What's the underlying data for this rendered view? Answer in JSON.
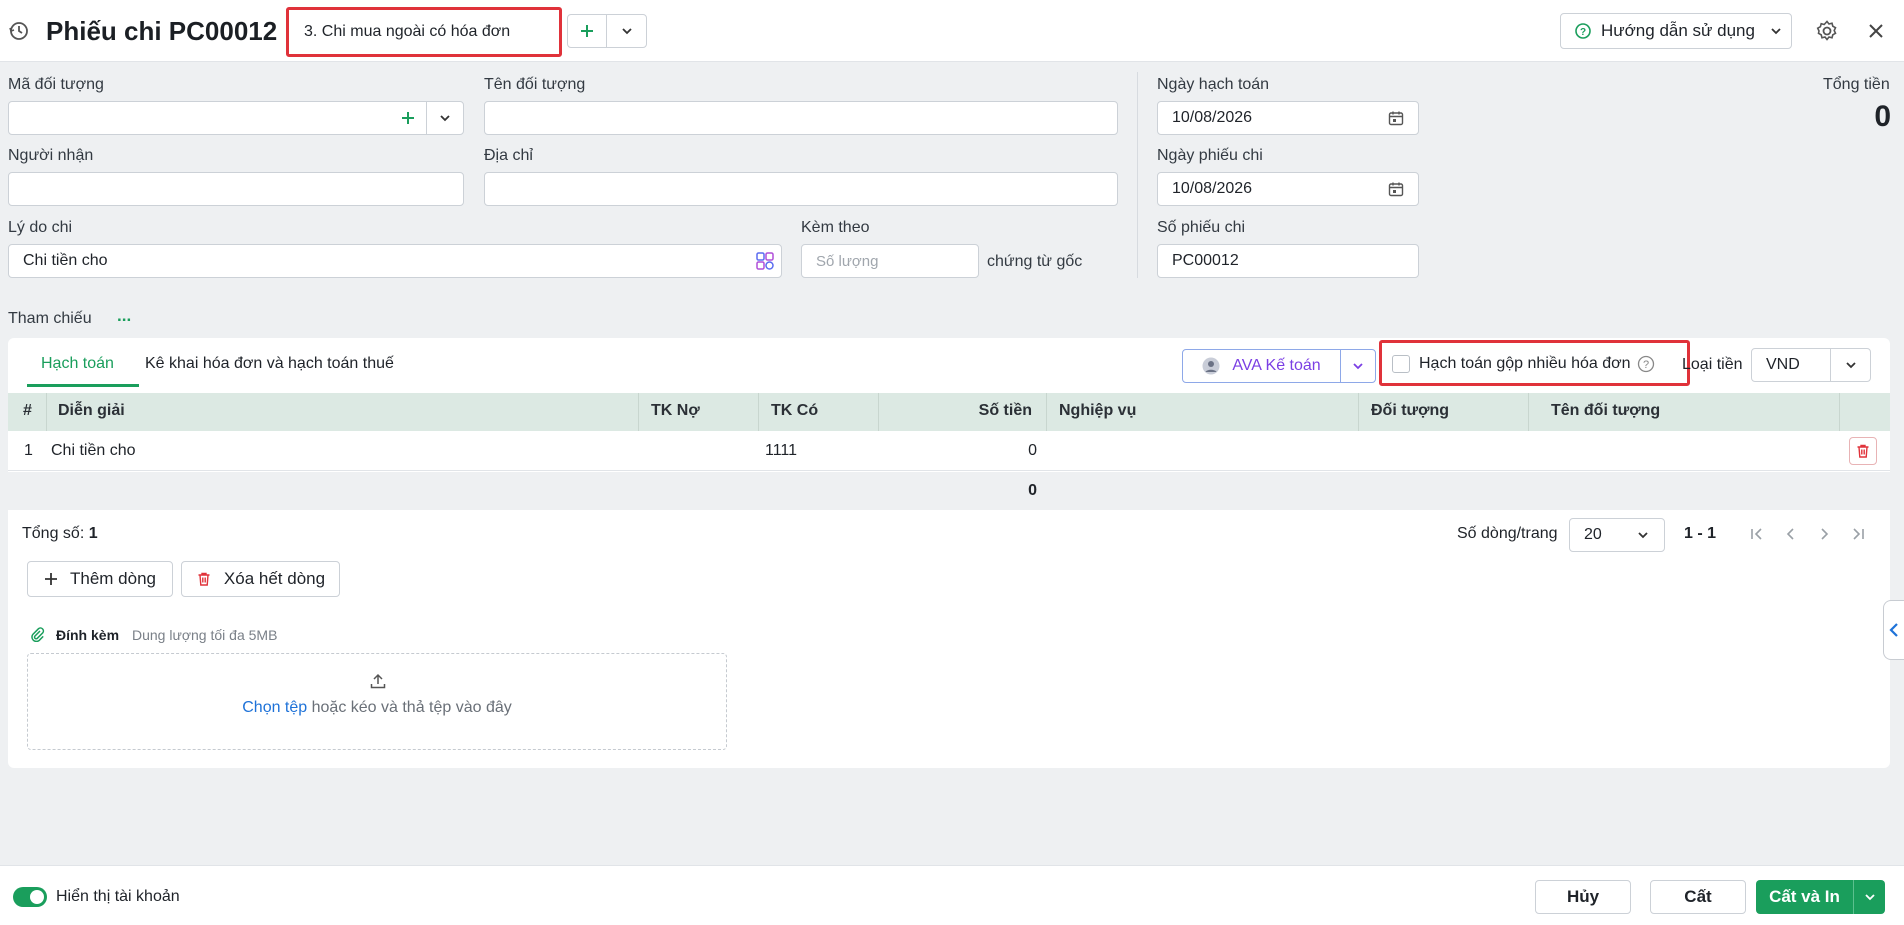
{
  "header": {
    "title": "Phiếu chi PC00012",
    "type_select": "3. Chi mua ngoài có hóa đơn",
    "help_label": "Hướng dẫn sử dụng"
  },
  "form": {
    "ma_doi_tuong_label": "Mã đối tượng",
    "ma_doi_tuong_value": "",
    "ten_doi_tuong_label": "Tên đối tượng",
    "ten_doi_tuong_value": "",
    "nguoi_nhan_label": "Người nhận",
    "nguoi_nhan_value": "",
    "dia_chi_label": "Địa chỉ",
    "dia_chi_value": "",
    "ly_do_chi_label": "Lý do chi",
    "ly_do_chi_value": "Chi tiền cho",
    "kem_theo_label": "Kèm theo",
    "kem_theo_placeholder": "Số lượng",
    "chung_tu_goc": "chứng từ gốc",
    "ngay_hach_toan_label": "Ngày hạch toán",
    "ngay_hach_toan_value": "10/08/2026",
    "ngay_phieu_chi_label": "Ngày phiếu chi",
    "ngay_phieu_chi_value": "10/08/2026",
    "so_phieu_chi_label": "Số phiếu chi",
    "so_phieu_chi_value": "PC00012",
    "tong_tien_label": "Tổng tiền",
    "tong_tien_value": "0",
    "tham_chieu_label": "Tham chiếu",
    "tham_chieu_more": "..."
  },
  "tabs": [
    {
      "label": "Hạch toán",
      "active": true
    },
    {
      "label": "Kê khai hóa đơn và hạch toán thuế",
      "active": false
    }
  ],
  "toolbar": {
    "ava_label": "AVA Kế toán",
    "gop_label": "Hạch toán gộp nhiều hóa đơn",
    "loai_tien_label": "Loại tiền",
    "loai_tien_value": "VND"
  },
  "grid": {
    "columns": [
      "#",
      "Diễn giải",
      "TK Nợ",
      "TK Có",
      "Số tiền",
      "Nghiệp vụ",
      "Đối tượng",
      "Tên đối tượng"
    ],
    "rows": [
      {
        "no": "1",
        "dien_giai": "Chi tiền cho",
        "tk_no": "",
        "tk_co": "1111",
        "so_tien": "0",
        "nghiep_vu": "",
        "doi_tuong": "",
        "ten_doi_tuong": ""
      }
    ],
    "total": "0"
  },
  "pager": {
    "tong_so_label": "Tổng số:",
    "tong_so_value": "1",
    "rows_per_page_label": "Số dòng/trang",
    "rows_per_page_value": "20",
    "range": "1 - 1"
  },
  "actions": {
    "add_row": "Thêm dòng",
    "delete_all": "Xóa hết dòng"
  },
  "attach": {
    "label": "Đính kèm",
    "limit": "Dung lượng tối đa 5MB",
    "choose": "Chọn tệp",
    "drag_text": "hoặc kéo và thả tệp vào đây"
  },
  "footer": {
    "toggle_label": "Hiển thị tài khoản",
    "cancel": "Hủy",
    "save": "Cất",
    "save_print": "Cất và In"
  },
  "colors": {
    "accent": "#1a9e5c",
    "highlight": "#e0323a",
    "ava": "#7b3fe4"
  }
}
